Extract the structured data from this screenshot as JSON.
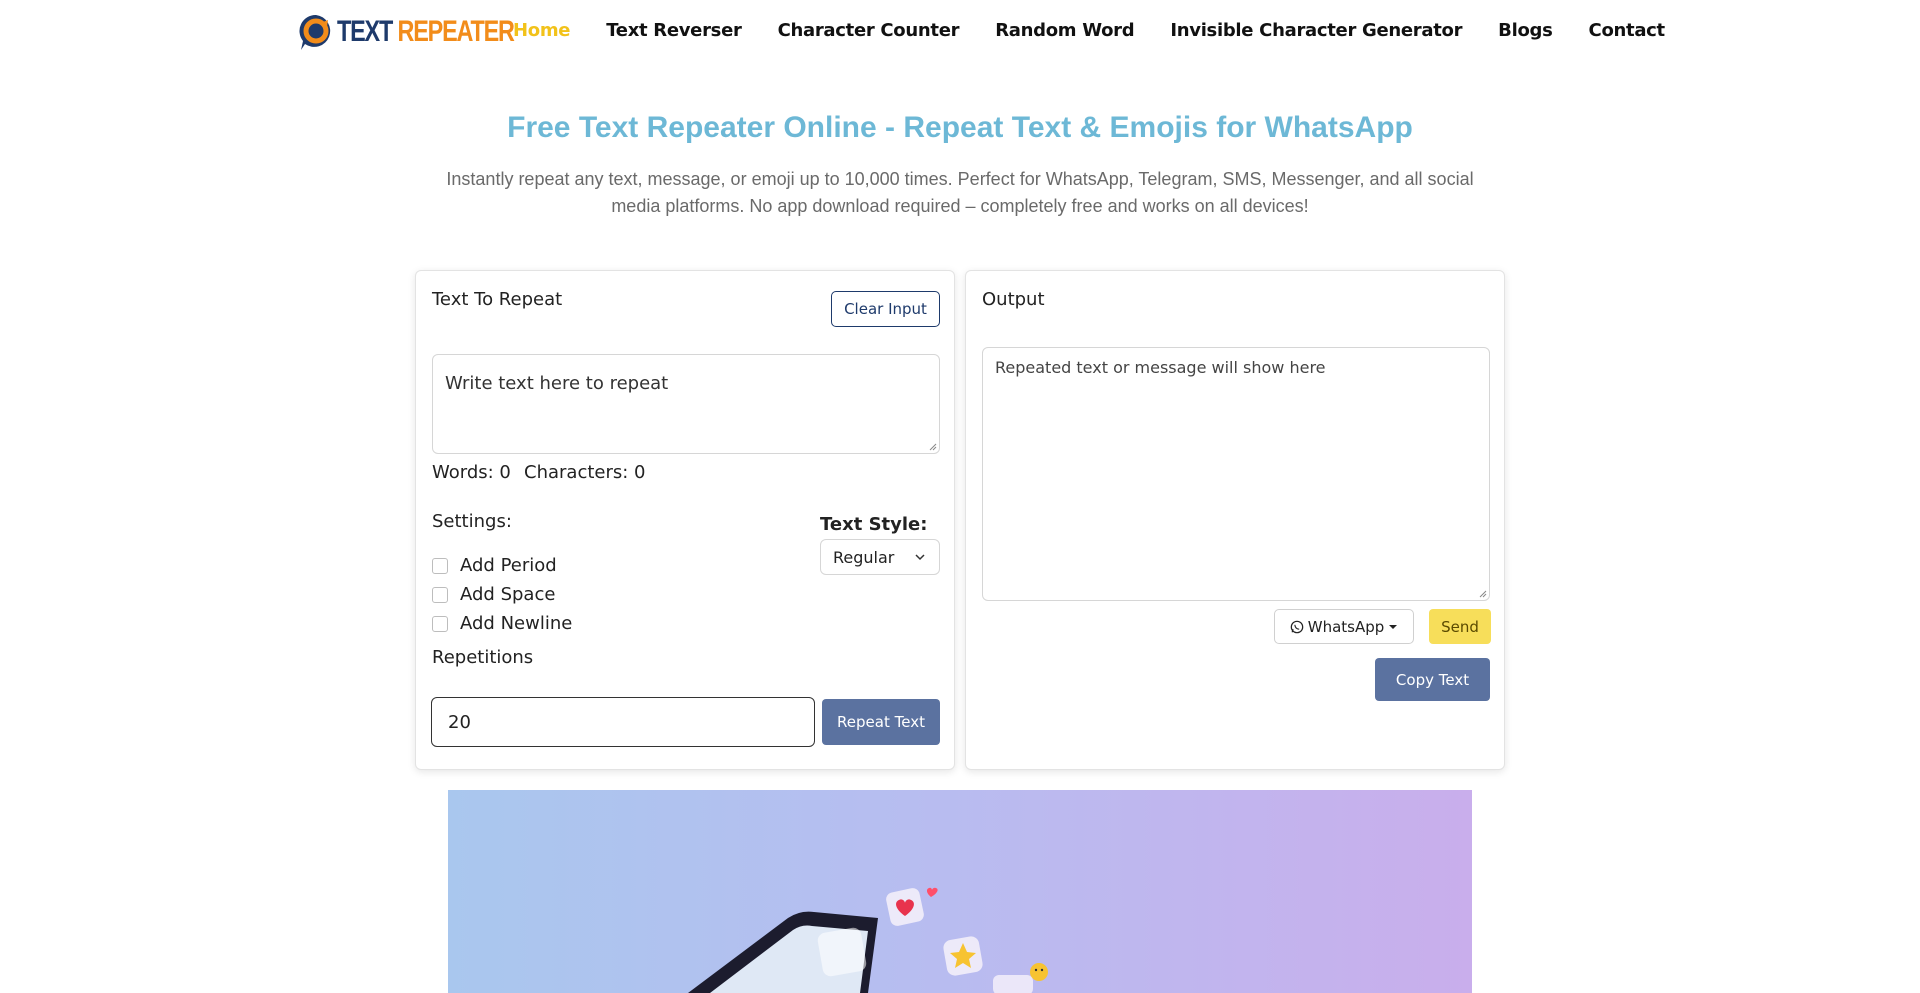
{
  "brand": {
    "logo_text_1": "TEXT ",
    "logo_text_2": "REPEATER"
  },
  "nav": {
    "items": [
      {
        "label": "Home",
        "active": true
      },
      {
        "label": "Text Reverser"
      },
      {
        "label": "Character Counter"
      },
      {
        "label": "Random Word"
      },
      {
        "label": "Invisible Character Generator"
      },
      {
        "label": "Blogs"
      },
      {
        "label": "Contact"
      }
    ]
  },
  "hero": {
    "title": "Free Text Repeater Online - Repeat Text & Emojis for WhatsApp",
    "subtitle": "Instantly repeat any text, message, or emoji up to 10,000 times. Perfect for WhatsApp, Telegram, SMS, Messenger, and all social media platforms. No app download required – completely free and works on all devices!"
  },
  "input_panel": {
    "title": "Text To Repeat",
    "clear_label": "Clear Input",
    "placeholder": "Write text here to repeat",
    "words_label": "Words: 0",
    "chars_label": "Characters: 0",
    "settings_label": "Settings:",
    "options": [
      "Add Period",
      "Add Space",
      "Add Newline"
    ],
    "text_style_label": "Text Style:",
    "text_style_value": "Regular",
    "repetitions_label": "Repetitions",
    "repetitions_value": "20",
    "repeat_label": "Repeat Text"
  },
  "output_panel": {
    "title": "Output",
    "placeholder": "Repeated text or message will show here",
    "share_target": "WhatsApp",
    "send_label": "Send",
    "copy_label": "Copy Text"
  },
  "colors": {
    "accent_title": "#6db8d6",
    "nav_active": "#f2c21a",
    "primary_button": "#5b72a0",
    "send_button": "#f7de5a",
    "brand_navy": "#1e3a6b",
    "brand_orange": "#f28c1a"
  }
}
